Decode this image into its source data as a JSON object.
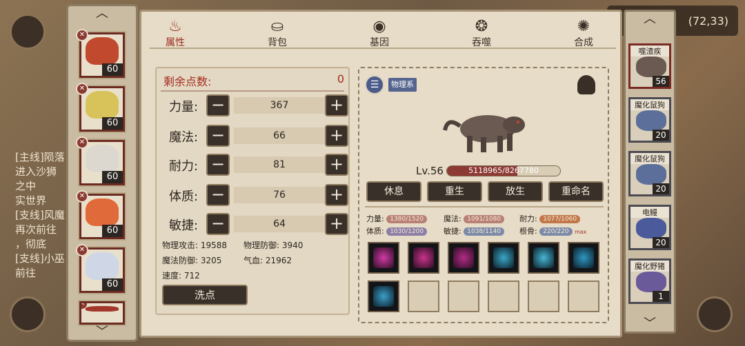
{
  "hud": {
    "coords": "(72,33)"
  },
  "chat": {
    "lines": [
      "[主线]陨落",
      "进入沙狮",
      "之中",
      "实世界",
      "[支线]风魔",
      "再次前往",
      "，彻底",
      "[支线]小巫",
      "前往"
    ]
  },
  "tabs": [
    {
      "label": "属性",
      "icon": "flame-icon",
      "selected": true
    },
    {
      "label": "背包",
      "icon": "bag-icon",
      "selected": false
    },
    {
      "label": "基因",
      "icon": "eye-icon",
      "selected": false
    },
    {
      "label": "吞噬",
      "icon": "swirl-icon",
      "selected": false
    },
    {
      "label": "合成",
      "icon": "spiral-icon",
      "selected": false
    }
  ],
  "left_roster": [
    {
      "level": "60",
      "color": "#c0492e",
      "badge": "✕"
    },
    {
      "level": "60",
      "color": "#d8c25a",
      "badge": "✕"
    },
    {
      "level": "60",
      "color": "#dcd8d0",
      "badge": "✕"
    },
    {
      "level": "60",
      "color": "#e06a3a",
      "badge": "✕"
    },
    {
      "level": "60",
      "color": "#cfd6e6",
      "badge": "✕"
    },
    {
      "level": "",
      "color": "#a2382c",
      "badge": "✕"
    }
  ],
  "stats": {
    "remaining_label": "剩余点数:",
    "remaining_value": "0",
    "rows": [
      {
        "name": "力量:",
        "value": "367"
      },
      {
        "name": "魔法:",
        "value": "66"
      },
      {
        "name": "耐力:",
        "value": "81"
      },
      {
        "name": "体质:",
        "value": "76"
      },
      {
        "name": "敏捷:",
        "value": "64"
      }
    ],
    "minus": "−",
    "plus": "+",
    "derived": {
      "phys_atk": "物理攻击: 19588",
      "phys_def": "物理防御: 3940",
      "mag_def": "魔法防御: 3205",
      "hp": "气血: 21962",
      "speed": "速度: 712"
    },
    "wash_button": "洗点"
  },
  "pet": {
    "element_tag": "物理系",
    "level": "Lv.56",
    "hp_text": "5118965/8267780",
    "hp_fraction": 0.619,
    "actions": [
      "休息",
      "重生",
      "放生",
      "重命名"
    ],
    "attrs": [
      {
        "label": "力量:",
        "value": "1380/1520",
        "color": "#b98076"
      },
      {
        "label": "魔法:",
        "value": "1091/1080",
        "color": "#b98076"
      },
      {
        "label": "耐力:",
        "value": "1077/1060",
        "color": "#c2774a"
      },
      {
        "label": "体质:",
        "value": "1030/1200",
        "color": "#8d7fa6"
      },
      {
        "label": "敏捷:",
        "value": "1038/1140",
        "color": "#7c8aa8"
      },
      {
        "label": "根骨:",
        "value": "220/220",
        "color": "#7c8aa8",
        "suffix": "max"
      }
    ],
    "skills": [
      {
        "icon": "magenta-slash-icon",
        "color": "#d13aa5"
      },
      {
        "icon": "magenta-claw-icon",
        "color": "#c9328c"
      },
      {
        "icon": "magenta-swirl-icon",
        "color": "#b32c86"
      },
      {
        "icon": "cyan-shield-icon",
        "color": "#3aa6c8"
      },
      {
        "icon": "cyan-shard-icon",
        "color": "#46b6d6"
      },
      {
        "icon": "cyan-wing-icon",
        "color": "#2f95c2"
      },
      {
        "icon": "cyan-storm-icon",
        "color": "#3c9ecb"
      }
    ],
    "empty_slots": 5
  },
  "right_roster": [
    {
      "name": "噬渣疾",
      "level": "56",
      "color": "#6b5a52",
      "selected": true
    },
    {
      "name": "魔化鼠狗",
      "level": "20",
      "color": "#5c6f9a",
      "selected": false
    },
    {
      "name": "魔化鼠狗",
      "level": "20",
      "color": "#5c6f9a",
      "selected": false
    },
    {
      "name": "电鳗",
      "level": "20",
      "color": "#4a5a9a",
      "selected": false
    },
    {
      "name": "魔化野猪",
      "level": "1",
      "color": "#6a5a9a",
      "selected": false
    }
  ]
}
